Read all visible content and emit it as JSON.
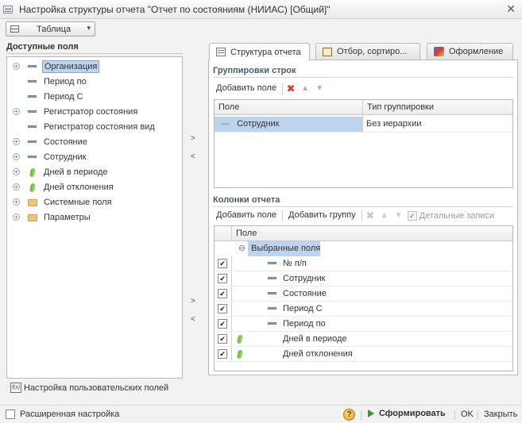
{
  "window": {
    "title": "Настройка структуры отчета \"Отчет по состояниям (НИИАС) [Общий]\"",
    "close_glyph": "✕"
  },
  "view_button": {
    "label": "Таблица",
    "icon": "table-icon",
    "arrow": "▾"
  },
  "available_fields": {
    "header": "Доступные поля",
    "items": [
      {
        "label": "Организация",
        "icon": "field-icon",
        "expandable": true,
        "selected": true
      },
      {
        "label": "Период по",
        "icon": "field-icon",
        "expandable": false
      },
      {
        "label": "Период С",
        "icon": "field-icon",
        "expandable": false
      },
      {
        "label": "Регистратор состояния",
        "icon": "field-icon",
        "expandable": true
      },
      {
        "label": "Регистратор состояния вид",
        "icon": "field-icon",
        "expandable": false
      },
      {
        "label": "Состояние",
        "icon": "field-icon",
        "expandable": true
      },
      {
        "label": "Сотрудник",
        "icon": "field-icon",
        "expandable": true
      },
      {
        "label": "Дней в периоде",
        "icon": "numeric-field-icon",
        "expandable": true
      },
      {
        "label": "Дней отклонения",
        "icon": "numeric-field-icon",
        "expandable": true
      },
      {
        "label": "Системные поля",
        "icon": "folder-icon",
        "expandable": true
      },
      {
        "label": "Параметры",
        "icon": "folder-icon",
        "expandable": true
      }
    ],
    "expander_glyph": "+",
    "custom_fields_label": "Настройка пользовательских полей",
    "custom_fields_icon_text": "f(x)"
  },
  "transfer": {
    "add_glyph": ">",
    "remove_glyph": "<"
  },
  "tabs": [
    {
      "label": "Структура отчета",
      "active": true
    },
    {
      "label": "Отбор, сортиро...",
      "active": false
    },
    {
      "label": "Оформление",
      "active": false
    }
  ],
  "row_groupings": {
    "title": "Группировки строк",
    "add_label": "Добавить поле",
    "delete_glyph": "✖",
    "up_glyph": "▲",
    "down_glyph": "▼",
    "columns": [
      "Поле",
      "Тип группировки"
    ],
    "rows": [
      {
        "field": "Сотрудник",
        "type": "Без иерархии"
      }
    ],
    "row_marker": "—"
  },
  "report_columns": {
    "title": "Колонки отчета",
    "add_field_label": "Добавить поле",
    "add_group_label": "Добавить группу",
    "detail_records_label": "Детальные записи",
    "check_glyph": "✔",
    "column_header": "Поле",
    "group_label": "Выбранные поля",
    "group_glyph": "⊖",
    "rows": [
      {
        "label": "№ п/п",
        "icon": "field-icon",
        "checked": true
      },
      {
        "label": "Сотрудник",
        "icon": "field-icon",
        "checked": true
      },
      {
        "label": "Состояние",
        "icon": "field-icon",
        "checked": true
      },
      {
        "label": "Период С",
        "icon": "field-icon",
        "checked": true
      },
      {
        "label": "Период по",
        "icon": "field-icon",
        "checked": true
      },
      {
        "label": "Дней в периоде",
        "icon": "numeric-field-icon",
        "checked": true
      },
      {
        "label": "Дней отклонения",
        "icon": "numeric-field-icon",
        "checked": true
      }
    ]
  },
  "bottom": {
    "advanced_label": "Расширенная настройка",
    "help_glyph": "?",
    "run_label": "Сформировать",
    "ok_label": "OK",
    "close_label": "Закрыть"
  },
  "colors": {
    "selection": "#bdd3ee",
    "section_title": "#4a5a6a",
    "run_icon": "#3a9a30",
    "delete_icon": "#d04040"
  }
}
